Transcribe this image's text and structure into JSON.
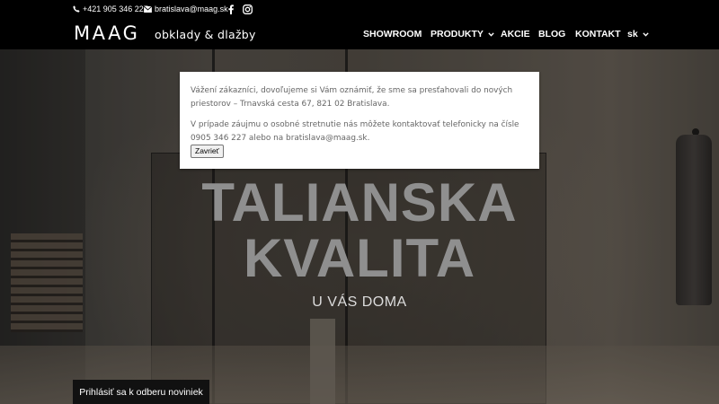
{
  "topbar": {
    "phone": "+421 905 346 227",
    "email": "bratislava@maag.sk",
    "icons": [
      "phone-icon",
      "email-icon",
      "facebook-icon",
      "instagram-icon"
    ]
  },
  "header": {
    "logo": "MAAG",
    "tagline": "obklady & dlažby",
    "nav": {
      "showroom": "SHOWROOM",
      "produkty": "PRODUKTY",
      "akcie": "AKCIE",
      "blog": "BLOG",
      "kontakt": "KONTAKT",
      "lang": "sk"
    }
  },
  "hero": {
    "title_line1": "TALIANSKA",
    "title_line2": "KVALITA",
    "subtitle": "U VÁS DOMA",
    "newsletter_button": "Prihlásiť sa k odberu noviniek"
  },
  "modal": {
    "paragraph1": "Vážení zákazníci, dovoľujeme si Vám oznámiť, že sme sa presťahovali do nových priestorov – Trnavská cesta 67, 821 02 Bratislava.",
    "paragraph2": "V prípade záujmu o osobné stretnutie nás môžete kontaktovať telefonicky na čísle 0905 346 227 alebo na bratislava@maag.sk.",
    "close_button": "Zavrieť"
  },
  "colors": {
    "header_bg": "#000000",
    "header_text": "#ffffff",
    "modal_bg": "#ffffff",
    "modal_text": "#666666",
    "hero_title": "#8f8f8f"
  }
}
